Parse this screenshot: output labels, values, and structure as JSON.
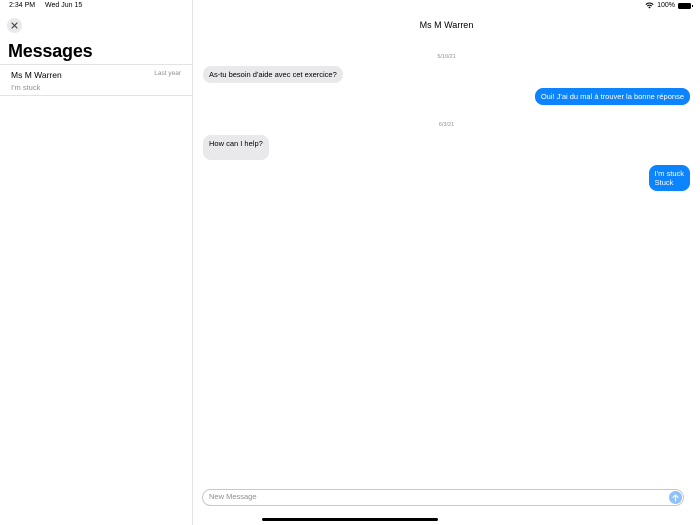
{
  "status_bar": {
    "time": "2:34 PM",
    "date": "Wed Jun 15",
    "battery": "100%"
  },
  "sidebar": {
    "title": "Messages",
    "conversations": [
      {
        "name": "Ms M Warren",
        "time": "Last year",
        "preview": "I'm stuck"
      }
    ]
  },
  "chat": {
    "contact_name": "Ms M Warren",
    "dates": [
      "5/10/21",
      "6/3/21"
    ],
    "messages": [
      {
        "direction": "incoming",
        "text": "As-tu besoin d'aide avec cet exercice?"
      },
      {
        "direction": "outgoing",
        "text": "Oui! J'ai du mal à trouver la bonne réponse"
      },
      {
        "direction": "incoming",
        "text": "How can I help?"
      },
      {
        "direction": "outgoing",
        "text": "I'm stuck",
        "text2": "Stuck"
      }
    ],
    "input_placeholder": "New Message"
  },
  "colors": {
    "outgoing_bubble": "#0b84fe",
    "incoming_bubble": "#e9e9eb",
    "send_button": "#8fc2fb"
  },
  "icons": [
    "close-icon",
    "wifi-icon",
    "battery-icon",
    "send-arrow-icon"
  ]
}
